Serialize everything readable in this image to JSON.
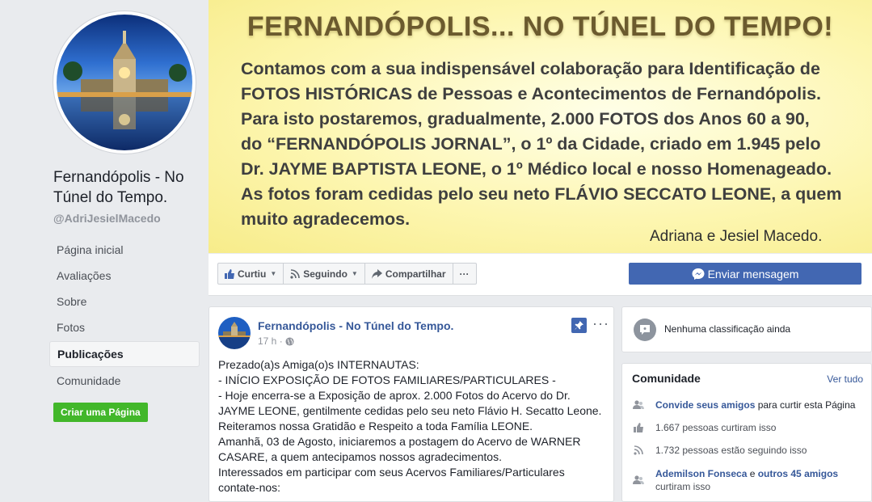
{
  "page": {
    "name": "Fernandópolis - No Túnel do Tempo.",
    "handle": "@AdriJesielMacedo"
  },
  "nav": {
    "items": [
      "Página inicial",
      "Avaliações",
      "Sobre",
      "Fotos",
      "Publicações",
      "Comunidade"
    ],
    "active": "Publicações"
  },
  "create_page_label": "Criar uma Página",
  "cover": {
    "title": "FERNANDÓPOLIS... NO TÚNEL DO TEMPO!",
    "lines": [
      "Contamos com a sua indispensável colaboração para Identificação de",
      "FOTOS HISTÓRICAS de Pessoas e Acontecimentos de Fernandópolis.",
      "Para isto postaremos, gradualmente, 2.000 FOTOS dos Anos 60 a 90,",
      "do “FERNANDÓPOLIS JORNAL”, o 1º da Cidade, criado em 1.945 pelo",
      "Dr. JAYME BAPTISTA LEONE, o 1º Médico local e nosso Homenageado.",
      "As fotos foram cedidas pelo seu neto FLÁVIO SECCATO LEONE, a quem",
      "muito agradecemos."
    ],
    "signature": "Adriana e Jesiel Macedo."
  },
  "actions": {
    "like": "Curtiu",
    "follow": "Seguindo",
    "share": "Compartilhar",
    "more": "···",
    "message": "Enviar mensagem"
  },
  "post": {
    "author": "Fernandópolis - No Túnel do Tempo.",
    "time": "17 h ·",
    "more": "···",
    "lines": [
      "Prezado(a)s Amiga(o)s INTERNAUTAS:",
      "- INÍCIO EXPOSIÇÃO DE FOTOS FAMILIARES/PARTICULARES -",
      "- Hoje encerra-se a Exposição de aprox. 2.000 Fotos do Acervo do Dr.",
      "JAYME LEONE, gentilmente cedidas pelo seu neto Flávio H. Secatto Leone.",
      "Reiteramos nossa Gratidão e Respeito a toda Família LEONE.",
      "Amanhã, 03 de Agosto, iniciaremos a postagem do Acervo de WARNER",
      "CASARE, a quem antecipamos nossos agradecimentos.",
      "Interessados em participar com seus Acervos Familiares/Particulares",
      "contate-nos:"
    ]
  },
  "rating": {
    "text": "Nenhuma classificação ainda"
  },
  "community": {
    "title": "Comunidade",
    "see_all": "Ver tudo",
    "invite_link": "Convide seus amigos",
    "invite_rest": " para curtir esta Página",
    "likes": "1.667 pessoas curtiram isso",
    "follows": "1.732 pessoas estão seguindo isso",
    "friend_name": "Ademilson Fonseca",
    "friend_and": " e ",
    "friend_others": "outros 45 amigos",
    "friend_rest": "curtiram isso"
  },
  "colors": {
    "facebook_blue": "#4267b2",
    "link_blue": "#365899",
    "green": "#42b72a",
    "cover_yellow": "#fdf6b0"
  }
}
